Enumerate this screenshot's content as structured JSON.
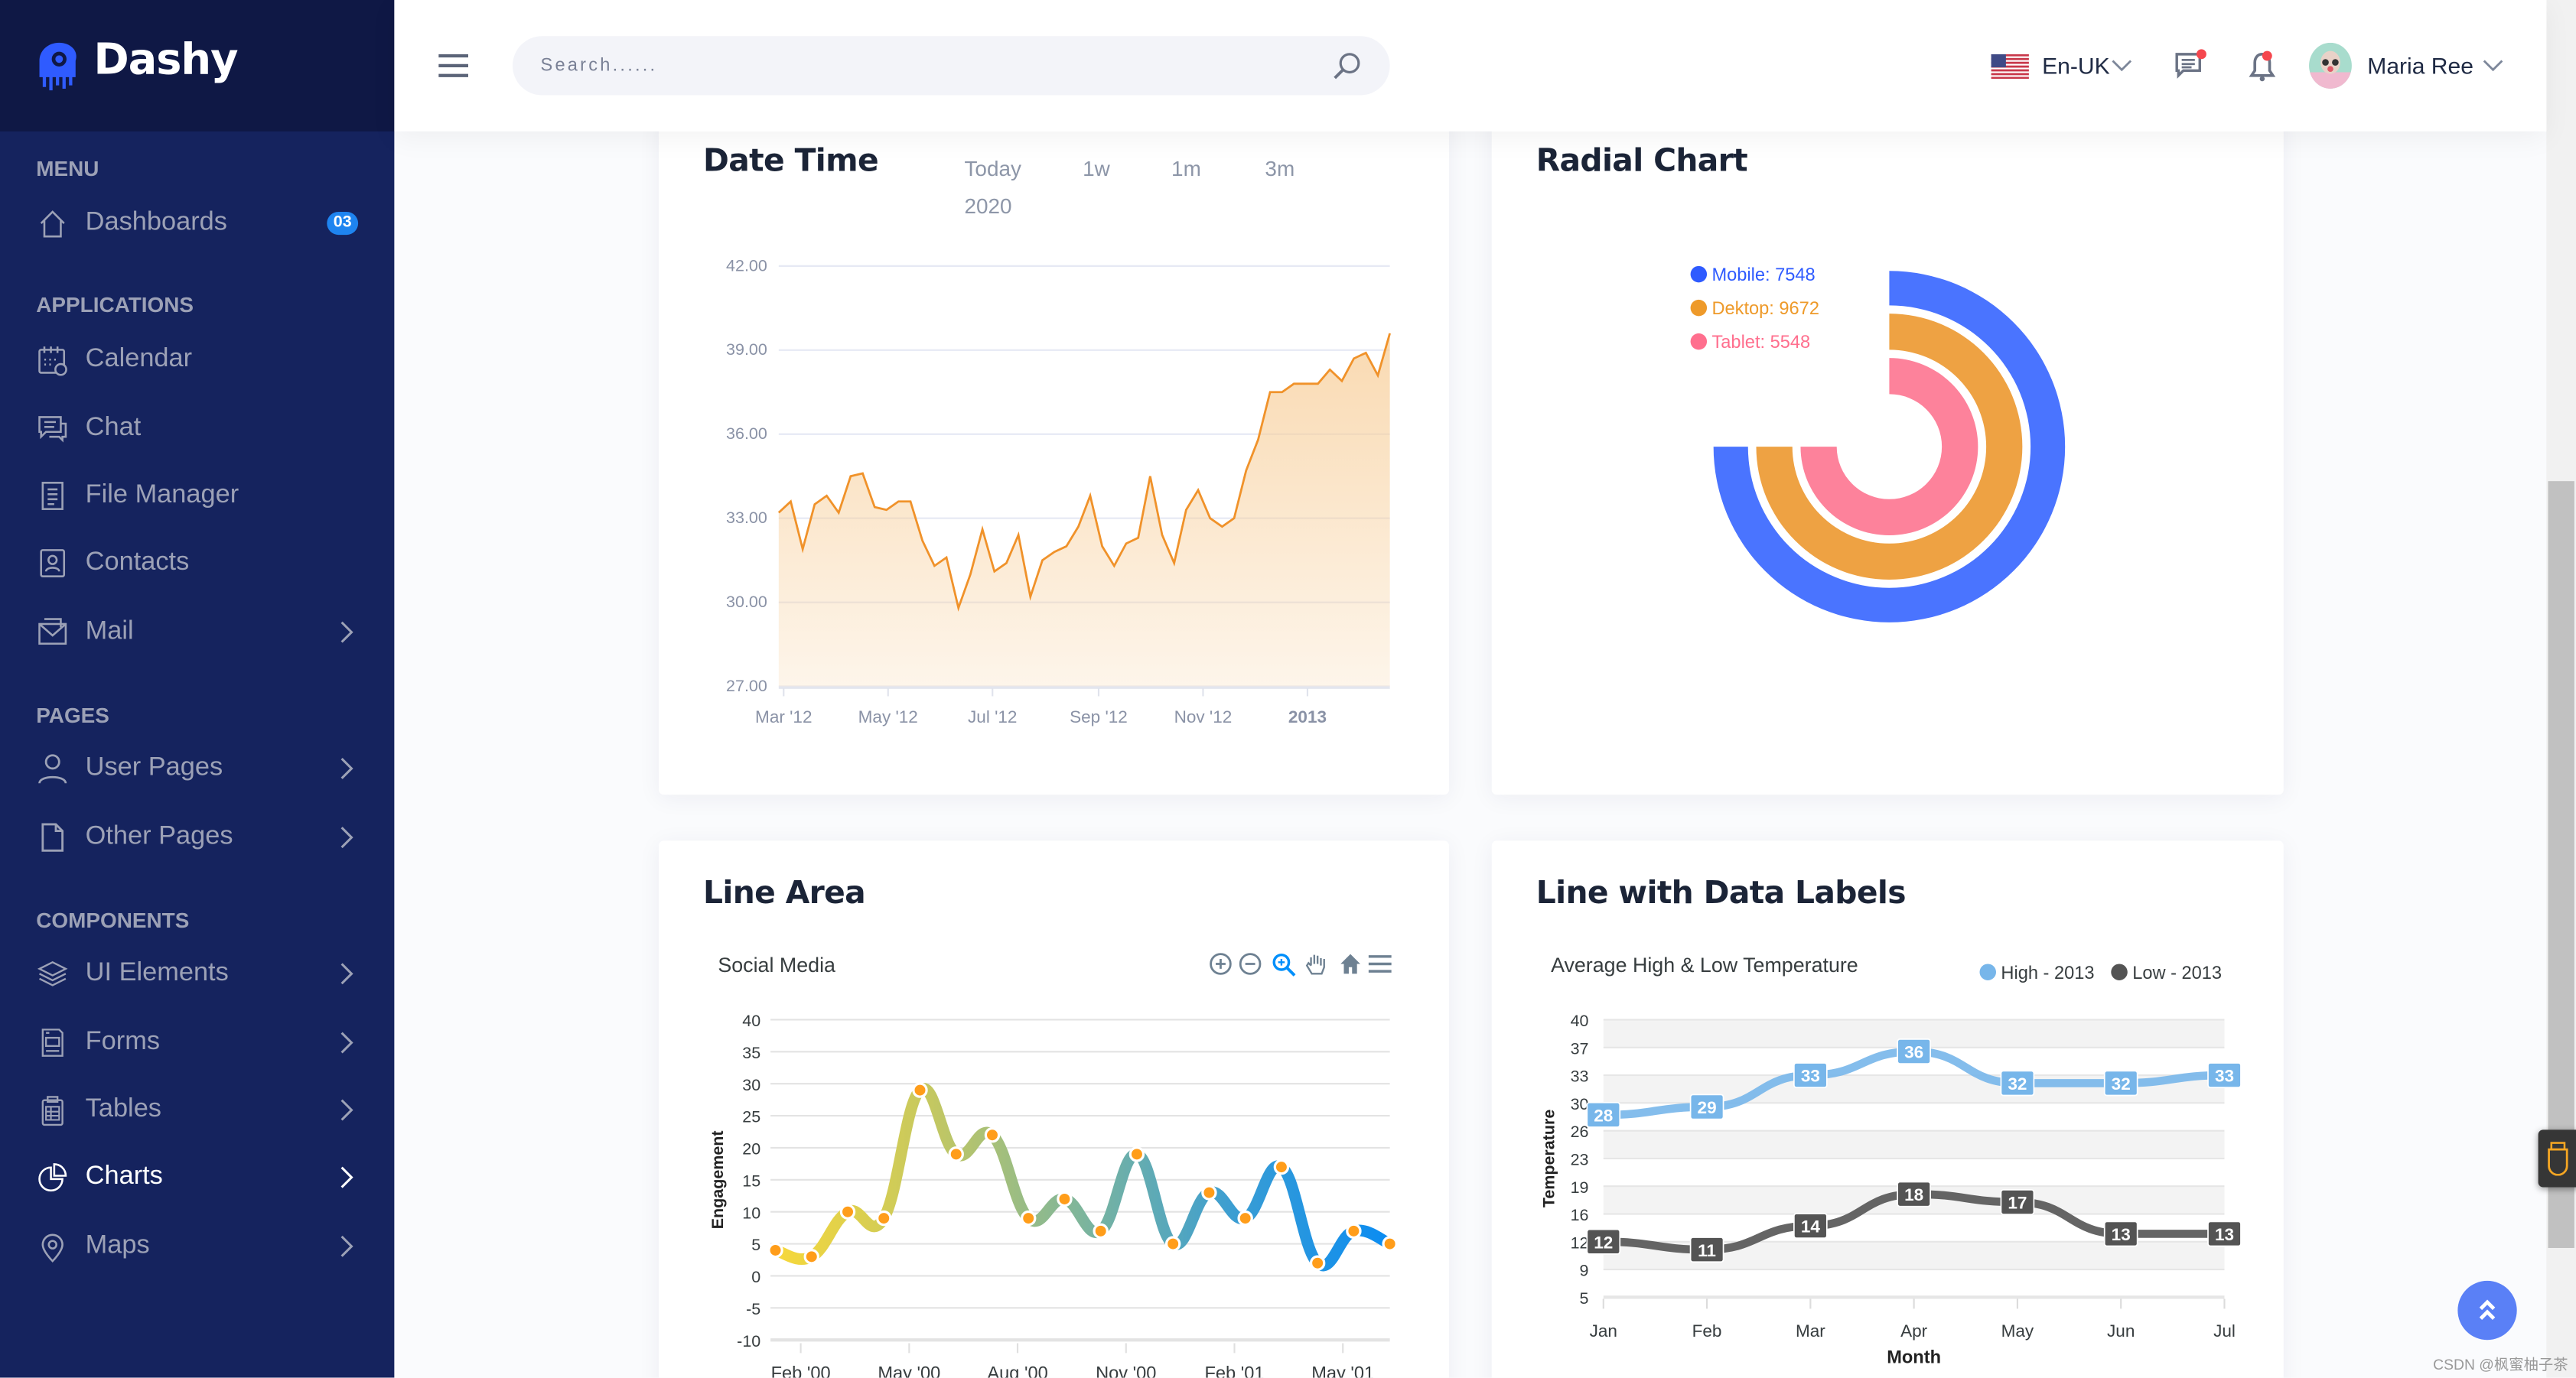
{
  "brand": {
    "name": "Dashy",
    "accent": "#2f5bff"
  },
  "header": {
    "search_placeholder": "Search......",
    "language": "En-UK",
    "user_name": "Maria Ree",
    "icons": [
      "menu-icon",
      "search-icon",
      "us-flag-icon",
      "chat-icon",
      "bell-icon"
    ]
  },
  "sidebar": {
    "sections": [
      {
        "title": "MENU",
        "items": [
          {
            "label": "Dashboards",
            "icon": "home-icon",
            "badge": "03"
          }
        ]
      },
      {
        "title": "APPLICATIONS",
        "items": [
          {
            "label": "Calendar",
            "icon": "calendar-icon"
          },
          {
            "label": "Chat",
            "icon": "chat-icon"
          },
          {
            "label": "File Manager",
            "icon": "file-icon"
          },
          {
            "label": "Contacts",
            "icon": "contacts-icon"
          },
          {
            "label": "Mail",
            "icon": "mail-icon",
            "chevron": true
          }
        ]
      },
      {
        "title": "PAGES",
        "items": [
          {
            "label": "User Pages",
            "icon": "user-icon",
            "chevron": true
          },
          {
            "label": "Other Pages",
            "icon": "page-icon",
            "chevron": true
          }
        ]
      },
      {
        "title": "COMPONENTS",
        "items": [
          {
            "label": "UI Elements",
            "icon": "layers-icon",
            "chevron": true
          },
          {
            "label": "Forms",
            "icon": "form-icon",
            "chevron": true
          },
          {
            "label": "Tables",
            "icon": "clipboard-icon",
            "chevron": true
          },
          {
            "label": "Charts",
            "icon": "pie-chart-icon",
            "chevron": true,
            "active": true
          },
          {
            "label": "Maps",
            "icon": "map-pin-icon",
            "chevron": true
          }
        ]
      }
    ]
  },
  "cards": {
    "datetime": {
      "title": "Date Time",
      "ranges": [
        "Today",
        "1w",
        "1m",
        "3m",
        "2020"
      ]
    },
    "radial": {
      "title": "Radial Chart"
    },
    "linearea": {
      "title": "Line Area",
      "toolbar": [
        "zoom-in-icon",
        "zoom-out-icon",
        "selection-zoom-icon",
        "pan-hand-icon",
        "home-reset-icon",
        "menu-icon"
      ]
    },
    "labels": {
      "title": "Line with Data Labels"
    }
  },
  "chart_data": [
    {
      "id": "datetime",
      "type": "area",
      "color": "#f0922a",
      "ylim": [
        27,
        42
      ],
      "yticks": [
        "42.00",
        "39.00",
        "36.00",
        "33.00",
        "30.00",
        "27.00"
      ],
      "ytick_values": [
        42,
        39,
        36,
        33,
        30,
        27
      ],
      "xticks": [
        {
          "label": "Mar '12",
          "date": "2012-03-01"
        },
        {
          "label": "May '12",
          "date": "2012-05-01"
        },
        {
          "label": "Jul '12",
          "date": "2012-07-01"
        },
        {
          "label": "Sep '12",
          "date": "2012-09-01"
        },
        {
          "label": "Nov '12",
          "date": "2012-11-01"
        },
        {
          "label": "2013",
          "date": "2013-01-01",
          "bold": true
        }
      ],
      "points": [
        [
          "2012-03-01",
          33.2
        ],
        [
          "2012-03-08",
          33.6
        ],
        [
          "2012-03-15",
          31.9
        ],
        [
          "2012-03-22",
          33.5
        ],
        [
          "2012-03-29",
          33.8
        ],
        [
          "2012-04-05",
          33.2
        ],
        [
          "2012-04-12",
          34.5
        ],
        [
          "2012-04-19",
          34.6
        ],
        [
          "2012-04-26",
          33.4
        ],
        [
          "2012-05-03",
          33.3
        ],
        [
          "2012-05-10",
          33.6
        ],
        [
          "2012-05-17",
          33.6
        ],
        [
          "2012-05-24",
          32.2
        ],
        [
          "2012-05-31",
          31.3
        ],
        [
          "2012-06-07",
          31.6
        ],
        [
          "2012-06-14",
          29.8
        ],
        [
          "2012-06-21",
          31.0
        ],
        [
          "2012-06-28",
          32.6
        ],
        [
          "2012-07-05",
          31.1
        ],
        [
          "2012-07-12",
          31.4
        ],
        [
          "2012-07-19",
          32.4
        ],
        [
          "2012-07-26",
          30.2
        ],
        [
          "2012-08-02",
          31.5
        ],
        [
          "2012-08-09",
          31.8
        ],
        [
          "2012-08-16",
          32.0
        ],
        [
          "2012-08-23",
          32.7
        ],
        [
          "2012-08-30",
          33.8
        ],
        [
          "2012-09-06",
          32.0
        ],
        [
          "2012-09-13",
          31.3
        ],
        [
          "2012-09-20",
          32.1
        ],
        [
          "2012-09-27",
          32.3
        ],
        [
          "2012-10-04",
          34.5
        ],
        [
          "2012-10-11",
          32.4
        ],
        [
          "2012-10-18",
          31.4
        ],
        [
          "2012-10-25",
          33.3
        ],
        [
          "2012-11-01",
          34.0
        ],
        [
          "2012-11-08",
          33.0
        ],
        [
          "2012-11-15",
          32.7
        ],
        [
          "2012-11-22",
          33.0
        ],
        [
          "2012-11-29",
          34.7
        ],
        [
          "2012-12-06",
          35.8
        ],
        [
          "2012-12-13",
          37.5
        ],
        [
          "2012-12-20",
          37.5
        ],
        [
          "2012-12-27",
          37.8
        ],
        [
          "2013-01-03",
          37.8
        ],
        [
          "2013-01-10",
          37.8
        ],
        [
          "2013-01-17",
          38.3
        ],
        [
          "2013-01-24",
          37.9
        ],
        [
          "2013-01-31",
          38.7
        ],
        [
          "2013-02-07",
          38.9
        ],
        [
          "2013-02-14",
          38.1
        ],
        [
          "2013-02-21",
          39.6
        ]
      ]
    },
    {
      "id": "radial",
      "type": "radialBar",
      "series": [
        {
          "name": "Mobile",
          "value": 7548,
          "label": "Mobile: 7548",
          "color": "#4a74ff",
          "legend_color": "#2f5bff"
        },
        {
          "name": "Dektop",
          "value": 9672,
          "label": "Dektop: 9672",
          "color": "#eea243",
          "legend_color": "#ee9a2a"
        },
        {
          "name": "Tablet",
          "value": 5548,
          "label": "Tablet: 5548",
          "color": "#fd829b",
          "legend_color": "#ff6f8e"
        }
      ],
      "legend_position": "top-left"
    },
    {
      "id": "linearea",
      "type": "line",
      "title": "Social Media",
      "ylabel": "Engagement",
      "ylim": [
        -10,
        40
      ],
      "yticks": [
        40,
        35,
        30,
        25,
        20,
        15,
        10,
        5,
        0,
        -5,
        -10
      ],
      "x": [
        "2000-01",
        "2000-02",
        "2000-03",
        "2000-04",
        "2000-05",
        "2000-06",
        "2000-07",
        "2000-08",
        "2000-09",
        "2000-10",
        "2000-11",
        "2000-12",
        "2001-01",
        "2001-02",
        "2001-03",
        "2001-04",
        "2001-05",
        "2001-06"
      ],
      "values": [
        4,
        3,
        10,
        9,
        29,
        19,
        22,
        9,
        12,
        7,
        19,
        5,
        13,
        9,
        17,
        2,
        7,
        5
      ],
      "xticks": [
        {
          "label": "Feb '00",
          "month": "2000-02"
        },
        {
          "label": "May '00",
          "month": "2000-05"
        },
        {
          "label": "Aug '00",
          "month": "2000-08"
        },
        {
          "label": "Nov '00",
          "month": "2000-11"
        },
        {
          "label": "Feb '01",
          "month": "2001-02"
        },
        {
          "label": "May '01",
          "month": "2001-05"
        }
      ],
      "gradient": [
        "#f7d83a",
        "#c5c860",
        "#7db59c",
        "#3a9dd3",
        "#0a8cf2"
      ],
      "marker_color": "#ff9d1a",
      "grid": true
    },
    {
      "id": "labels",
      "type": "line",
      "title": "Average High & Low Temperature",
      "xlabel": "Month",
      "ylabel": "Temperature",
      "ylim": [
        5,
        40
      ],
      "yticks": [
        "40",
        "37",
        "33",
        "30",
        "26",
        "23",
        "19",
        "16",
        "12",
        "9",
        "5"
      ],
      "categories": [
        "Jan",
        "Feb",
        "Mar",
        "Apr",
        "May",
        "Jun",
        "Jul"
      ],
      "series": [
        {
          "name": "High - 2013",
          "values": [
            28,
            29,
            33,
            36,
            32,
            32,
            33
          ],
          "color": "#77b6ea"
        },
        {
          "name": "Low - 2013",
          "values": [
            12,
            11,
            14,
            18,
            17,
            13,
            13
          ],
          "color": "#545454"
        }
      ],
      "legend_position": "top-right",
      "grid": true
    }
  ],
  "watermark": "CSDN @枫蜜柚子茶"
}
